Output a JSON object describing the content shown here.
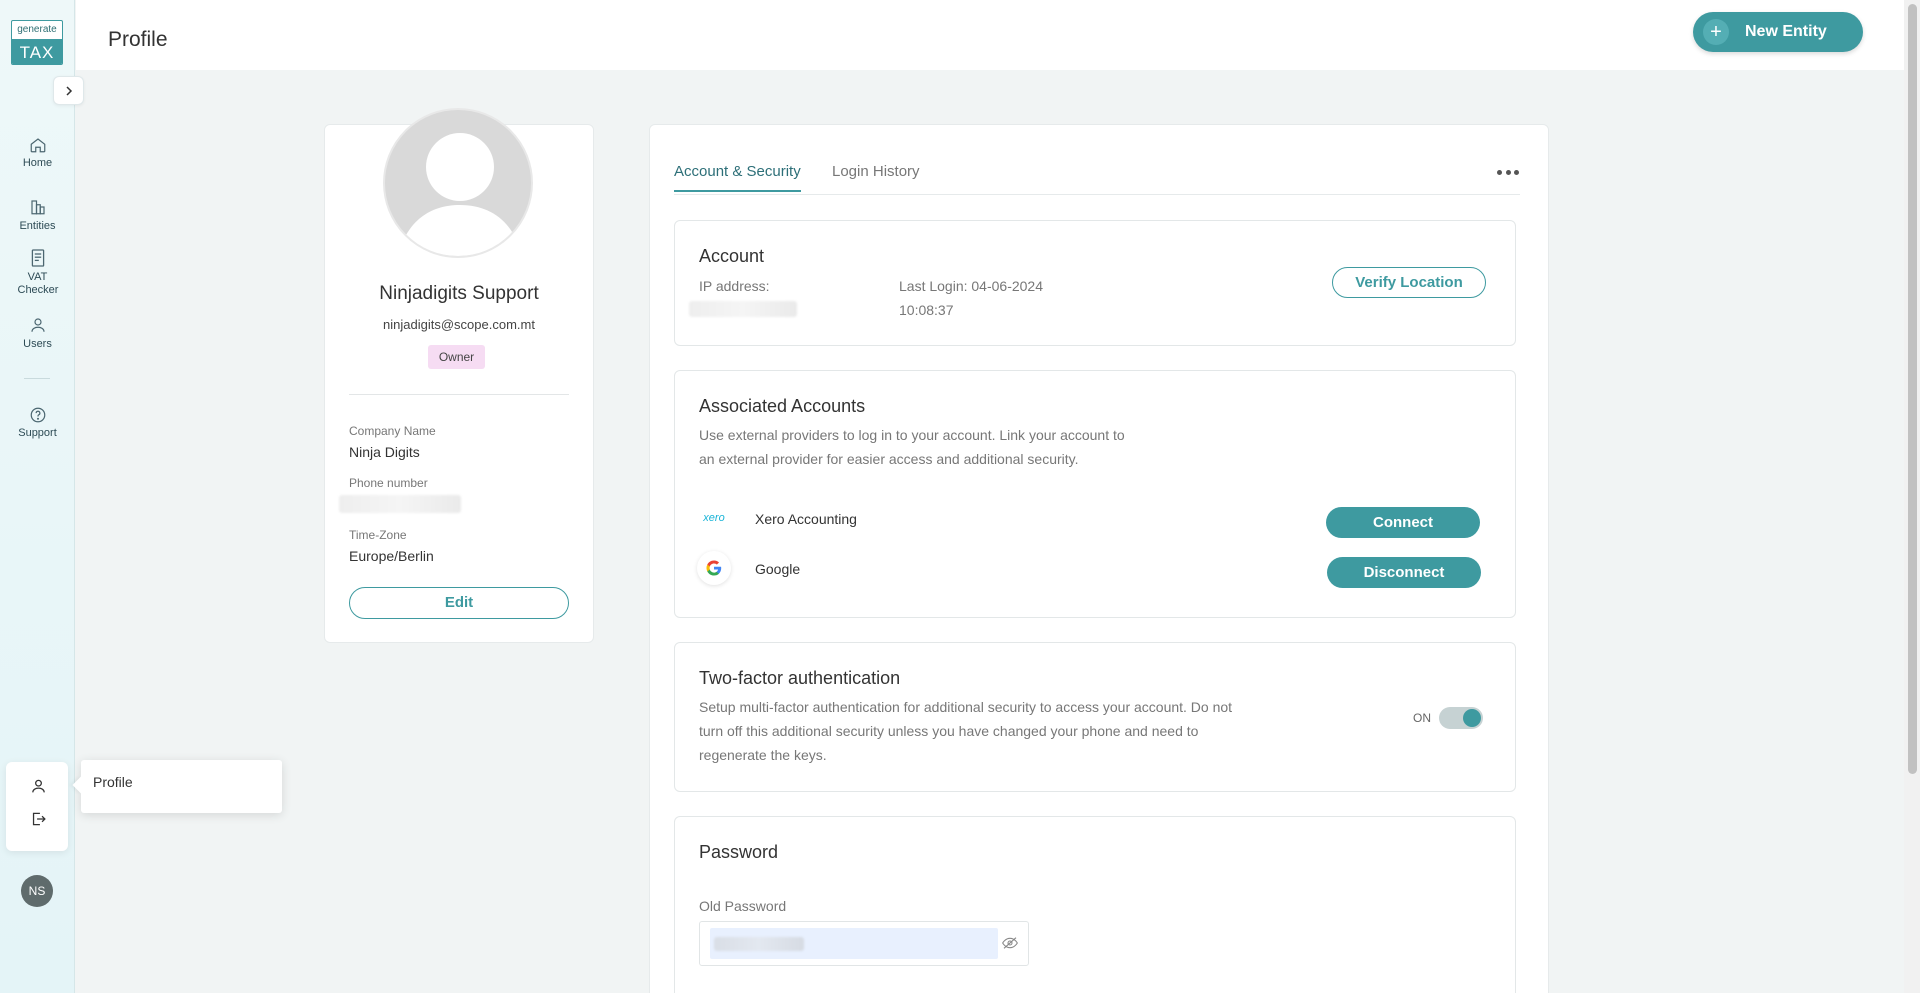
{
  "app": {
    "logo_top": "generate",
    "logo_bottom": "TAX"
  },
  "sidebar": {
    "items": [
      {
        "label": "Home",
        "icon": "home-icon"
      },
      {
        "label": "Entities",
        "icon": "building-icon"
      },
      {
        "label": "VAT Checker",
        "icon": "document-icon"
      },
      {
        "label": "Users",
        "icon": "user-icon"
      },
      {
        "label": "Support",
        "icon": "help-icon"
      }
    ],
    "avatar_initials": "NS",
    "tooltip_label": "Profile"
  },
  "header": {
    "title": "Profile",
    "new_entity_label": "New Entity",
    "new_entity_icon": "+"
  },
  "profile": {
    "name": "Ninjadigits Support",
    "email": "ninjadigits@scope.com.mt",
    "role_badge": "Owner",
    "company_label": "Company Name",
    "company_value": "Ninja Digits",
    "phone_label": "Phone number",
    "timezone_label": "Time-Zone",
    "timezone_value": "Europe/Berlin",
    "edit_label": "Edit"
  },
  "tabs": [
    {
      "label": "Account & Security",
      "active": true
    },
    {
      "label": "Login History",
      "active": false
    }
  ],
  "account": {
    "title": "Account",
    "ip_label": "IP address:",
    "last_login_line1": "Last Login: 04-06-2024",
    "last_login_line2": "10:08:37",
    "verify_label": "Verify Location"
  },
  "associated": {
    "title": "Associated Accounts",
    "desc_line1": "Use external providers to log in to your account. Link your account to",
    "desc_line2": "an external provider for easier access and additional security.",
    "providers": [
      {
        "name": "Xero Accounting",
        "icon_text": "xero",
        "action": "Connect"
      },
      {
        "name": "Google",
        "icon_text": "G",
        "action": "Disconnect"
      }
    ]
  },
  "twofa": {
    "title": "Two-factor authentication",
    "desc_line1": "Setup multi-factor authentication for additional security to access your account. Do not",
    "desc_line2": "turn off this additional security unless you have changed your phone and need to",
    "desc_line3": "regenerate the keys.",
    "toggle_label": "ON",
    "enabled": true
  },
  "password": {
    "title": "Password",
    "old_label": "Old Password"
  },
  "colors": {
    "accent": "#3e9aa0",
    "badge": "#f6dcf3"
  }
}
